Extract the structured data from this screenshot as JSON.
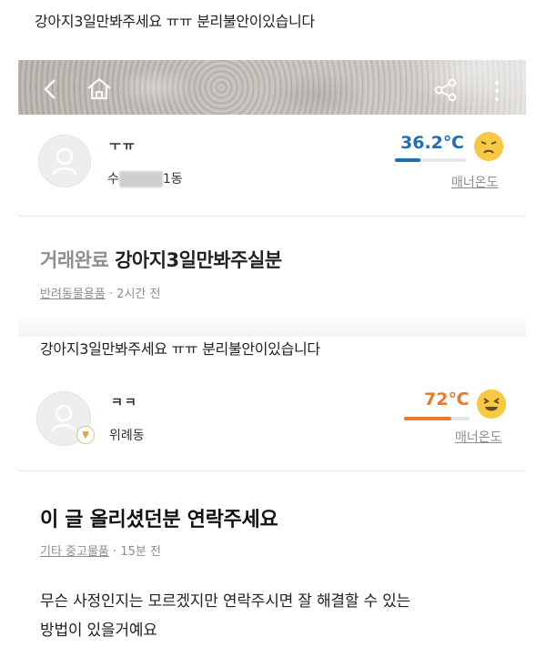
{
  "top_caption": "강아지3일만봐주세요 ㅠㅠ 분리불안이있습니다",
  "card1": {
    "seller_name": "ㅜㅠ",
    "seller_location_prefix": "수",
    "seller_location_suffix": "1동",
    "temperature": "36.2℃",
    "temperature_level": 0.36,
    "temperature_color": "#1f6fb8",
    "manner_label": "매너온도",
    "emoji": "frown-face-icon"
  },
  "post1": {
    "status": "거래완료",
    "title": "강아지3일만봐주실분",
    "category": "반려동물용품",
    "time": "· 2시간 전"
  },
  "mid_caption": "강아지3일만봐주세요 ㅠㅠ 분리불안이있습니다",
  "card2": {
    "seller_name": "ㅋㅋ",
    "seller_location": "위례동",
    "temperature": "72℃",
    "temperature_level": 0.72,
    "temperature_color": "#e67a2f",
    "manner_label": "매너온도",
    "emoji": "laughing-face-icon"
  },
  "post2": {
    "title": "이 글 올리셨던분 연락주세요",
    "category": "기타 중고물품",
    "time": "· 15분 전",
    "body_line1": "무슨 사정인지는 모르겠지만 연락주시면 잘 해결할 수 있는",
    "body_line2": "방법이 있을거예요"
  }
}
